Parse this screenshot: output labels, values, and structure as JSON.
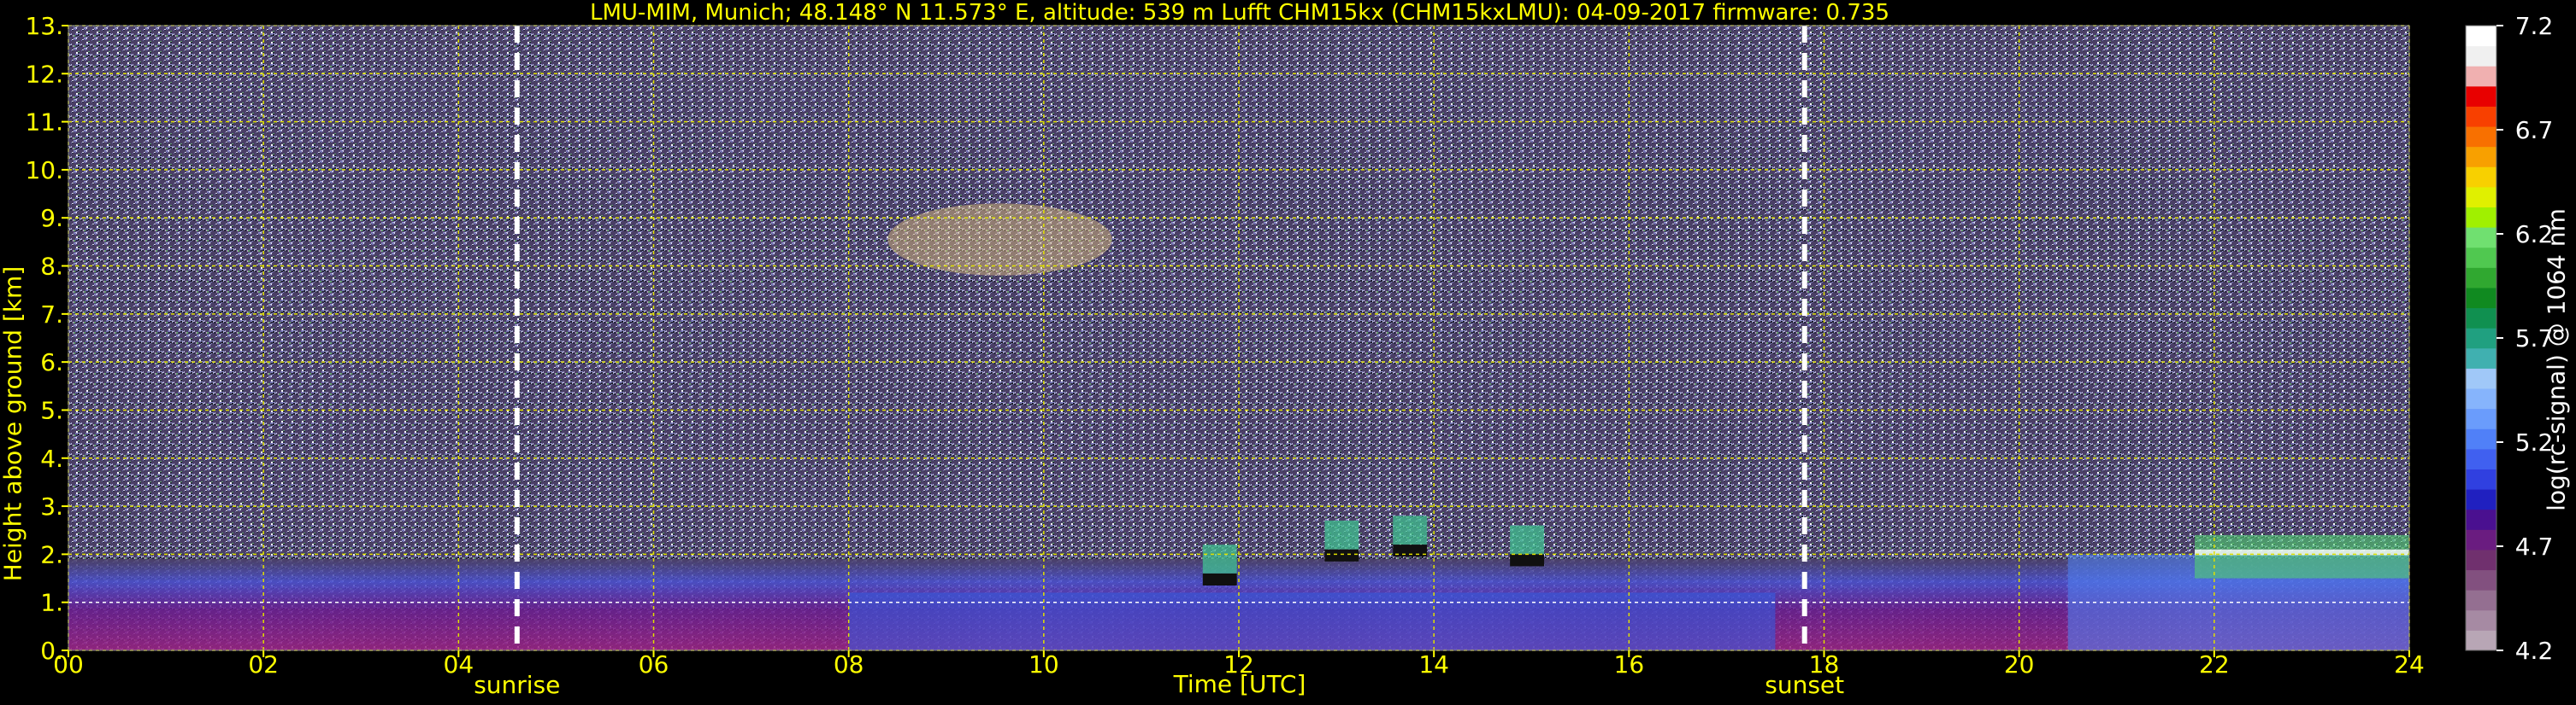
{
  "chart_data": {
    "type": "heatmap",
    "title": "LMU-MIM, Munich; 48.148° N 11.573° E, altitude: 539 m     Lufft CHM15kx (CHM15kxLMU): 04-09-2017     firmware: 0.735",
    "xlabel": "Time [UTC]",
    "ylabel": "Height above ground [km]",
    "xlim": [
      0,
      24
    ],
    "ylim": [
      0,
      13
    ],
    "x_ticks": [
      "00",
      "02",
      "04",
      "06",
      "08",
      "10",
      "12",
      "14",
      "16",
      "18",
      "20",
      "22",
      "24"
    ],
    "y_ticks": [
      "0.",
      "1.",
      "2.",
      "3.",
      "4.",
      "5.",
      "6.",
      "7.",
      "8.",
      "9.",
      "10.",
      "11.",
      "12.",
      "13."
    ],
    "grid": true,
    "events": [
      {
        "label": "sunrise",
        "time": 4.6
      },
      {
        "label": "sunset",
        "time": 17.8
      }
    ],
    "colorbar": {
      "label": "log(rc-signal) @ 1064 nm",
      "range": [
        4.2,
        7.2
      ],
      "ticks": [
        "4.2",
        "4.7",
        "5.2",
        "5.7",
        "6.2",
        "6.7",
        "7.2"
      ],
      "colors": [
        "#b8a6b5",
        "#a68aa3",
        "#946f91",
        "#82507f",
        "#70306e",
        "#6a1c80",
        "#4a1090",
        "#2020c0",
        "#3040e0",
        "#4060f0",
        "#5080f8",
        "#6a9cfc",
        "#86b4fc",
        "#a0c8f8",
        "#40b0b0",
        "#20a080",
        "#109050",
        "#108a20",
        "#30a830",
        "#50c850",
        "#70e070",
        "#a0f000",
        "#e0f000",
        "#f8d000",
        "#f8a000",
        "#f87000",
        "#f84000",
        "#e80000",
        "#f0b0b0",
        "#f0f0f0",
        "#ffffff"
      ]
    },
    "features": [
      {
        "name": "boundary layer aerosol",
        "time_range": [
          0,
          24
        ],
        "height_range": [
          0,
          1.9
        ]
      },
      {
        "name": "cirrus cloud",
        "time_range": [
          8.4,
          10.7
        ],
        "height_range": [
          7.8,
          9.3
        ]
      },
      {
        "name": "low cumulus clouds",
        "time_range": [
          11.7,
          15.3
        ],
        "height_range": [
          1.4,
          2.9
        ]
      },
      {
        "name": "evening cloud layer",
        "time_range": [
          21.8,
          24
        ],
        "height_range": [
          1.5,
          2.4
        ]
      }
    ]
  }
}
